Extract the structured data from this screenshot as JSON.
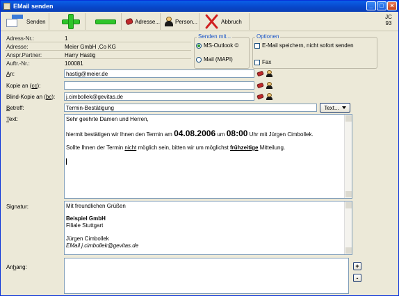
{
  "window": {
    "title": "EMail senden"
  },
  "toolbar": {
    "send_label": "Senden",
    "address_label": "Adresse...",
    "person_label": "Person...",
    "cancel_label": "Abbruch",
    "user_code_line1": "JC",
    "user_code_line2": "93"
  },
  "header": {
    "address_no_label": "Adress-Nr.:",
    "address_no": "1",
    "address_label": "Adresse:",
    "address": "Meier GmbH ,Co KG",
    "contact_label": "Anspr.Partner:",
    "contact": "Harry Hastig",
    "order_label": "Auftr.-Nr.:",
    "order": "100081"
  },
  "send_with": {
    "title": "Senden mit...",
    "options": [
      "MS-Outlook ©",
      "Mail (MAPI)"
    ],
    "selected": "MS-Outlook ©"
  },
  "options": {
    "title": "Optionen",
    "save_only": "E-Mail speichern, nicht sofort senden",
    "fax": "Fax"
  },
  "fields": {
    "to_label_pre": "",
    "to_label_u": "A",
    "to_label_post": "n:",
    "to_value": "hastig@meier.de",
    "cc_label_pre": "Kopie an (",
    "cc_label_u": "cc",
    "cc_label_post": "):",
    "cc_value": "",
    "bcc_label_pre": "Blind-Kopie an (",
    "bcc_label_u": "bc",
    "bcc_label_post": "):",
    "bcc_value": "j.cimbollek@gevitas.de",
    "subject_label_pre": "",
    "subject_label_u": "B",
    "subject_label_post": "etreff:",
    "subject_value": "Termin-Bestätigung",
    "text_button": "Text...",
    "text_label_pre": "",
    "text_label_u": "T",
    "text_label_post": "ext:",
    "signature_label": "Signatur:",
    "attachment_label_pre": "An",
    "attachment_label_u": "h",
    "attachment_label_post": "ang:"
  },
  "message": {
    "greeting": "Sehr geehrte Damen und Herren,",
    "line2_a": "hiermit bestätigen wir Ihnen den Termin am",
    "line2_date": "04.08.2006",
    "line2_b": "um",
    "line2_time": "08:00",
    "line2_c": "Uhr mit Jürgen Cimbollek.",
    "line3_a": "Sollte Ihnen der Termin",
    "line3_not": "nicht",
    "line3_b": "möglich sein, bitten wir um möglichst",
    "line3_early": "frühzeitige",
    "line3_c": "Mitteilung."
  },
  "signature": {
    "closing": "Mit freundlichen Grüßen",
    "company": "Beispiel GmbH",
    "branch": "Filiale Stuttgart",
    "name": "Jürgen Cimbollek",
    "email": "EMail j.cimbollek@gevitas.de"
  },
  "attachments": {
    "add": "+",
    "remove": "-"
  }
}
